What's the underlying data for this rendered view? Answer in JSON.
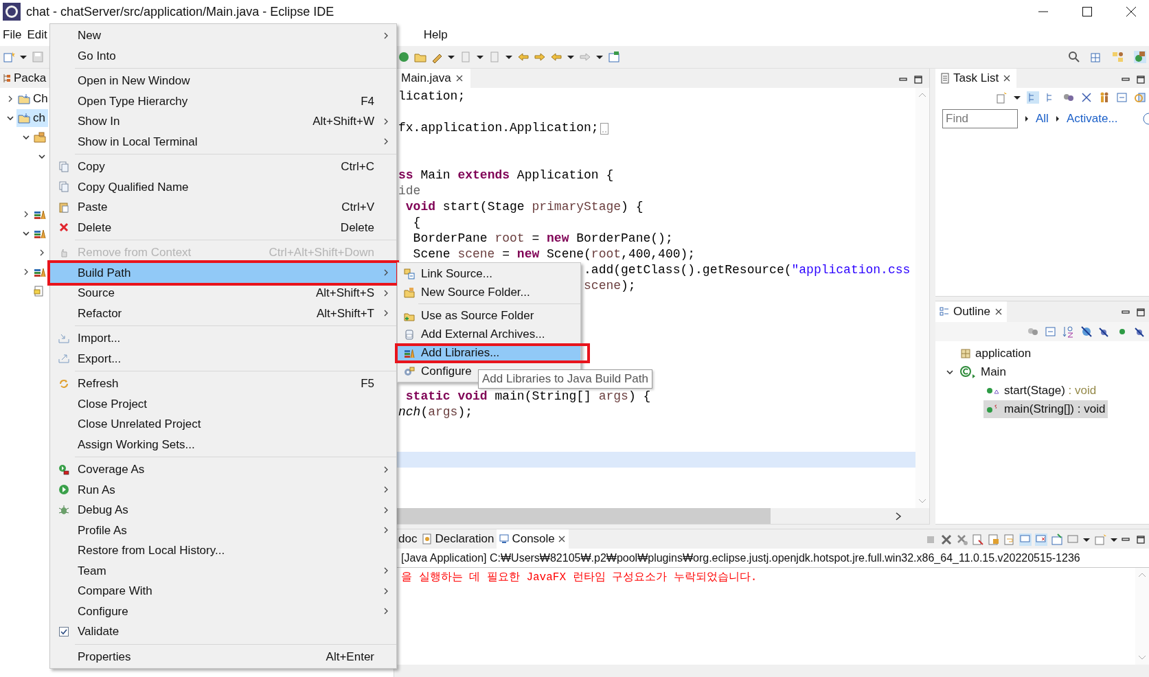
{
  "window": {
    "title": "chat - chatServer/src/application/Main.java - Eclipse IDE"
  },
  "menu_bar": [
    "File",
    "Edit",
    "Help"
  ],
  "package_explorer": {
    "tab": "Packa",
    "tree": [
      {
        "label": "Ch",
        "kind": "project",
        "expanded": false,
        "selected": false
      },
      {
        "label": "ch",
        "kind": "project",
        "expanded": true,
        "selected": true,
        "children": [
          {
            "kind": "folder",
            "expanded": true,
            "selected": false,
            "children": [
              {
                "expanded": true,
                "selected": false
              }
            ]
          },
          {
            "kind": "library",
            "expanded": false,
            "selected": false
          },
          {
            "kind": "library",
            "expanded": true,
            "selected": false,
            "children": [
              {
                "expanded": false,
                "selected": false
              }
            ]
          },
          {
            "kind": "library",
            "expanded": false,
            "selected": false
          },
          {
            "kind": "file",
            "selected": false
          }
        ]
      }
    ]
  },
  "editor": {
    "tab": {
      "label": "Main.java",
      "selected": true
    },
    "lines": [
      {
        "current": false,
        "tokens": [
          {
            "kind": "plain",
            "text": "lication;"
          }
        ]
      },
      {
        "current": false
      },
      {
        "current": false,
        "folded": true,
        "tokens": [
          {
            "kind": "plain",
            "text": "fx.application.Application;"
          }
        ]
      },
      {
        "current": false
      },
      {
        "current": false
      },
      {
        "current": false,
        "tokens": [
          {
            "kind": "kw",
            "text": "ss"
          },
          {
            "kind": "plain",
            "text": " Main "
          },
          {
            "kind": "kw",
            "text": "extends"
          },
          {
            "kind": "plain",
            "text": " Application {"
          }
        ]
      },
      {
        "current": false,
        "tokens": [
          {
            "kind": "annotation",
            "text": "ide"
          }
        ]
      },
      {
        "current": false,
        "tokens": [
          {
            "kind": "kw",
            "text": " void"
          },
          {
            "kind": "plain",
            "text": " start(Stage "
          },
          {
            "kind": "var",
            "text": "primaryStage"
          },
          {
            "kind": "plain",
            "text": ") {"
          }
        ]
      },
      {
        "current": false,
        "tokens": [
          {
            "kind": "plain",
            "text": "  {"
          }
        ]
      },
      {
        "current": false,
        "tokens": [
          {
            "kind": "plain",
            "text": "  BorderPane "
          },
          {
            "kind": "var",
            "text": "root"
          },
          {
            "kind": "plain",
            "text": " = "
          },
          {
            "kind": "kw",
            "text": "new"
          },
          {
            "kind": "plain",
            "text": " BorderPane();"
          }
        ]
      },
      {
        "current": false,
        "tokens": [
          {
            "kind": "plain",
            "text": "  Scene "
          },
          {
            "kind": "var",
            "text": "scene"
          },
          {
            "kind": "plain",
            "text": " = "
          },
          {
            "kind": "kw",
            "text": "new"
          },
          {
            "kind": "plain",
            "text": " Scene("
          },
          {
            "kind": "var",
            "text": "root"
          },
          {
            "kind": "plain",
            "text": ",400,400);"
          }
        ]
      },
      {
        "current": false,
        "tokens": [
          {
            "kind": "plain",
            "text": "                         .add(getClass().getResource("
          },
          {
            "kind": "string",
            "text": "\"application.css"
          }
        ]
      },
      {
        "current": false,
        "tokens": [
          {
            "kind": "var",
            "text": "                         scene"
          },
          {
            "kind": "plain",
            "text": ");"
          }
        ]
      },
      {
        "current": false
      },
      {
        "current": false
      },
      {
        "current": false
      },
      {
        "current": false
      },
      {
        "current": false
      },
      {
        "current": false
      },
      {
        "current": false,
        "tokens": [
          {
            "kind": "kw",
            "text": " static"
          },
          {
            "kind": "kw",
            "text": " void"
          },
          {
            "kind": "plain",
            "text": " main(String[] "
          },
          {
            "kind": "var",
            "text": "args"
          },
          {
            "kind": "plain",
            "text": ") {"
          }
        ]
      },
      {
        "current": false,
        "tokens": [
          {
            "kind": "static_call",
            "text": "nch"
          },
          {
            "kind": "plain",
            "text": "("
          },
          {
            "kind": "var",
            "text": "args"
          },
          {
            "kind": "plain",
            "text": ");"
          }
        ]
      },
      {
        "current": false
      },
      {
        "current": false
      },
      {
        "current": true
      }
    ]
  },
  "context_menu": {
    "items": [
      {
        "kind": "item",
        "label": "New",
        "submenu": true,
        "disabled": false,
        "highlighted": false,
        "marked": false
      },
      {
        "kind": "item",
        "label": "Go Into",
        "submenu": false,
        "disabled": false,
        "highlighted": false,
        "marked": false
      },
      {
        "kind": "separator"
      },
      {
        "kind": "item",
        "label": "Open in New Window",
        "submenu": false,
        "disabled": false,
        "highlighted": false,
        "marked": false
      },
      {
        "kind": "item",
        "label": "Open Type Hierarchy",
        "shortcut": "F4",
        "submenu": false,
        "disabled": false,
        "highlighted": false,
        "marked": false
      },
      {
        "kind": "item",
        "label": "Show In",
        "shortcut": "Alt+Shift+W",
        "submenu": true,
        "disabled": false,
        "highlighted": false,
        "marked": false
      },
      {
        "kind": "item",
        "label": "Show in Local Terminal",
        "submenu": true,
        "disabled": false,
        "highlighted": false,
        "marked": false
      },
      {
        "kind": "separator"
      },
      {
        "kind": "item",
        "label": "Copy",
        "shortcut": "Ctrl+C",
        "submenu": false,
        "disabled": false,
        "highlighted": false,
        "marked": false
      },
      {
        "kind": "item",
        "label": "Copy Qualified Name",
        "submenu": false,
        "disabled": false,
        "highlighted": false,
        "marked": false
      },
      {
        "kind": "item",
        "label": "Paste",
        "shortcut": "Ctrl+V",
        "submenu": false,
        "disabled": false,
        "highlighted": false,
        "marked": false
      },
      {
        "kind": "item",
        "label": "Delete",
        "shortcut": "Delete",
        "submenu": false,
        "disabled": false,
        "highlighted": false,
        "marked": false
      },
      {
        "kind": "separator"
      },
      {
        "kind": "item",
        "label": "Remove from Context",
        "shortcut": "Ctrl+Alt+Shift+Down",
        "submenu": false,
        "disabled": true,
        "highlighted": false,
        "marked": false
      },
      {
        "kind": "item",
        "label": "Build Path",
        "submenu": true,
        "disabled": false,
        "highlighted": true,
        "marked": true
      },
      {
        "kind": "item",
        "label": "Source",
        "shortcut": "Alt+Shift+S",
        "submenu": true,
        "disabled": false,
        "highlighted": false,
        "marked": false
      },
      {
        "kind": "item",
        "label": "Refactor",
        "shortcut": "Alt+Shift+T",
        "submenu": true,
        "disabled": false,
        "highlighted": false,
        "marked": false
      },
      {
        "kind": "separator"
      },
      {
        "kind": "item",
        "label": "Import...",
        "submenu": false,
        "disabled": false,
        "highlighted": false,
        "marked": false
      },
      {
        "kind": "item",
        "label": "Export...",
        "submenu": false,
        "disabled": false,
        "highlighted": false,
        "marked": false
      },
      {
        "kind": "separator"
      },
      {
        "kind": "item",
        "label": "Refresh",
        "shortcut": "F5",
        "submenu": false,
        "disabled": false,
        "highlighted": false,
        "marked": false
      },
      {
        "kind": "item",
        "label": "Close Project",
        "submenu": false,
        "disabled": false,
        "highlighted": false,
        "marked": false
      },
      {
        "kind": "item",
        "label": "Close Unrelated Project",
        "submenu": false,
        "disabled": false,
        "highlighted": false,
        "marked": false
      },
      {
        "kind": "item",
        "label": "Assign Working Sets...",
        "submenu": false,
        "disabled": false,
        "highlighted": false,
        "marked": false
      },
      {
        "kind": "separator"
      },
      {
        "kind": "item",
        "label": "Coverage As",
        "submenu": true,
        "disabled": false,
        "highlighted": false,
        "marked": false
      },
      {
        "kind": "item",
        "label": "Run As",
        "submenu": true,
        "disabled": false,
        "highlighted": false,
        "marked": false
      },
      {
        "kind": "item",
        "label": "Debug As",
        "submenu": true,
        "disabled": false,
        "highlighted": false,
        "marked": false
      },
      {
        "kind": "item",
        "label": "Profile As",
        "submenu": true,
        "disabled": false,
        "highlighted": false,
        "marked": false
      },
      {
        "kind": "item",
        "label": "Restore from Local History...",
        "submenu": false,
        "disabled": false,
        "highlighted": false,
        "marked": false
      },
      {
        "kind": "item",
        "label": "Team",
        "submenu": true,
        "disabled": false,
        "highlighted": false,
        "marked": false
      },
      {
        "kind": "item",
        "label": "Compare With",
        "submenu": true,
        "disabled": false,
        "highlighted": false,
        "marked": false
      },
      {
        "kind": "item",
        "label": "Configure",
        "submenu": true,
        "disabled": false,
        "highlighted": false,
        "marked": false
      },
      {
        "kind": "check",
        "label": "Validate",
        "checked": true,
        "submenu": false,
        "disabled": false,
        "highlighted": false,
        "marked": false
      },
      {
        "kind": "separator"
      },
      {
        "kind": "item",
        "label": "Properties",
        "shortcut": "Alt+Enter",
        "submenu": false,
        "disabled": false,
        "highlighted": false,
        "marked": false
      }
    ]
  },
  "submenu": {
    "items": [
      {
        "kind": "item",
        "label": "Link Source...",
        "highlighted": false,
        "marked": false
      },
      {
        "kind": "item",
        "label": "New Source Folder...",
        "highlighted": false,
        "marked": false
      },
      {
        "kind": "separator"
      },
      {
        "kind": "item",
        "label": "Use as Source Folder",
        "highlighted": false,
        "marked": false
      },
      {
        "kind": "item",
        "label": "Add External Archives...",
        "highlighted": false,
        "marked": false
      },
      {
        "kind": "item",
        "label": "Add Libraries...",
        "highlighted": true,
        "marked": true
      },
      {
        "kind": "item",
        "label": "Configure",
        "highlighted": false,
        "marked": false
      }
    ]
  },
  "tooltip": "Add Libraries to Java Build Path",
  "task_list": {
    "tab": "Task List",
    "find": {
      "placeholder": "Find"
    },
    "links": [
      "All",
      "Activate..."
    ]
  },
  "outline": {
    "tab": "Outline",
    "tree": [
      {
        "label": "application",
        "kind": "package",
        "selected": false
      },
      {
        "label": "Main",
        "kind": "class",
        "expanded": true,
        "selected": false,
        "children": [
          {
            "label": "start(Stage)",
            "type": " : void",
            "kind": "override_method",
            "selected": false
          },
          {
            "label": "main(String[])",
            "type": " : void",
            "kind": "static_method",
            "selected": true
          }
        ]
      }
    ]
  },
  "console": {
    "tabs": [
      {
        "label": "doc",
        "selected": false
      },
      {
        "label": "Declaration",
        "selected": false
      },
      {
        "label": "Console",
        "selected": true
      }
    ],
    "process": "[Java Application] C:₩Users₩82105₩.p2₩pool₩plugins₩org.eclipse.justj.openjdk.hotspot.jre.full.win32.x86_64_11.0.15.v20220515-1236",
    "output": [
      {
        "kind": "error",
        "text": "을 실행하는 데 필요한 JavaFX 런타임 구성요소가 누락되었습니다."
      }
    ]
  }
}
